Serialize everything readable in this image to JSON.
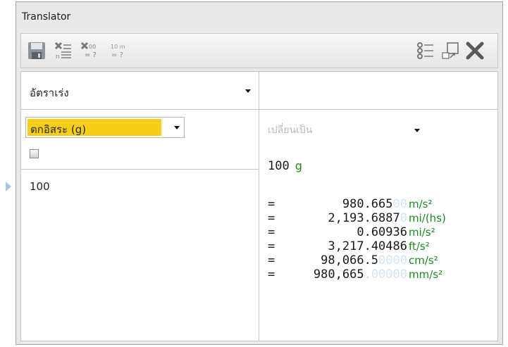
{
  "window": {
    "title": "Translator"
  },
  "toolbar": {
    "left_buttons": [
      {
        "icon": "save-icon"
      },
      {
        "icon": "clear-list-icon"
      },
      {
        "icon": "clear-result-icon",
        "text_top": "00",
        "text_bottom": "= ?"
      },
      {
        "icon": "unit-result-icon",
        "text_top": "10 m",
        "text_bottom": "= ?"
      }
    ],
    "right_buttons": [
      {
        "icon": "list-options-icon"
      },
      {
        "icon": "resize-window-icon"
      },
      {
        "icon": "close-icon"
      }
    ]
  },
  "quantity": {
    "selected": "อัตราเร่ง"
  },
  "from_unit": {
    "selected": "ตกอิสระ (g)",
    "highlight_color": "#f7cf1b"
  },
  "input": {
    "value": "100"
  },
  "to_unit": {
    "placeholder": "เปลี่ยนเป็น"
  },
  "source": {
    "value": "100",
    "unit": "g"
  },
  "results": [
    {
      "eq": "=",
      "main": "980.665",
      "faded": "00",
      "unit": "m/s²"
    },
    {
      "eq": "=",
      "main": "2,193.6887",
      "faded": "0",
      "unit": "mi/(hs)"
    },
    {
      "eq": "=",
      "main": "0.60936",
      "faded": "",
      "unit": "mi/s²"
    },
    {
      "eq": "=",
      "main": "3,217.40486",
      "faded": "",
      "unit": "ft/s²"
    },
    {
      "eq": "=",
      "main": "98,066.5",
      "faded": "0000",
      "unit": "cm/s²"
    },
    {
      "eq": "=",
      "main": "980,665",
      "faded": ".00000",
      "unit": "mm/s²"
    }
  ],
  "colors": {
    "unit_green": "#1d8a1d",
    "faded_digits": "#d3e6f5"
  }
}
